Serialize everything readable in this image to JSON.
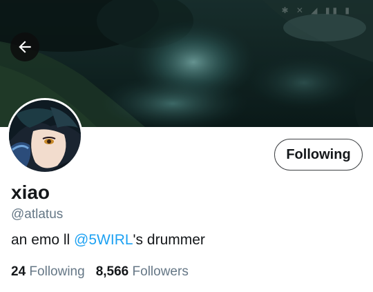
{
  "header": {
    "back_icon": "arrow-left-icon",
    "status_icons": [
      "bluetooth-icon",
      "mute-icon",
      "wifi-icon",
      "signal-icon",
      "battery-icon"
    ]
  },
  "profile": {
    "display_name": "xiao",
    "handle": "@atlatus",
    "follow_button_label": "Following",
    "bio": {
      "prefix": "an emo ll ",
      "mention": "@5WIRL",
      "suffix": "'s drummer"
    },
    "stats": {
      "following_count": "24",
      "following_label": "Following",
      "followers_count": "8,566",
      "followers_label": "Followers"
    }
  },
  "colors": {
    "accent": "#1da1f2",
    "text_primary": "#14171a",
    "text_secondary": "#657786",
    "banner_dark": "#0f2524"
  }
}
